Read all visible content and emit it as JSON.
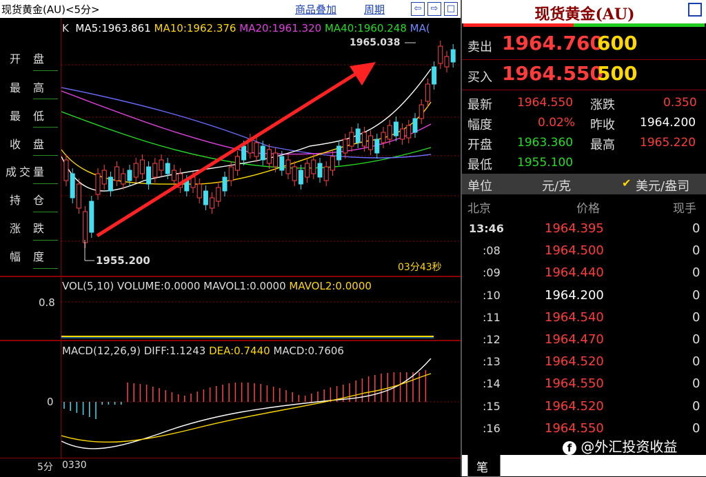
{
  "header": {
    "title": "现货黄金(AU)<5分>",
    "overlay_label": "商品叠加",
    "period_label": "周期",
    "nav_prev": "⇦",
    "nav_next": "⇨",
    "nav_layout": "□"
  },
  "left_labels": [
    "开盘",
    "最高",
    "最低",
    "收盘",
    "成交量",
    "持仓",
    "涨跌",
    "幅度"
  ],
  "kline_legend": {
    "prefix": "K",
    "ma5": "MA5:1963.861",
    "ma10": "MA10:1962.376",
    "ma20": "MA20:1961.320",
    "ma40": "MA40:1960.248",
    "ma_more": "MA(",
    "colors": {
      "ma5": "#ffffff",
      "ma10": "#ffd800",
      "ma20": "#e040e0",
      "ma40": "#22dd22"
    }
  },
  "annotations": {
    "high": "1965.038",
    "low": "1955.200",
    "countdown": "03分43秒"
  },
  "volume_legend": {
    "label": "VOL(5,10) VOLUME:0.0000 MAVOL1:0.0000",
    "mavol2": "MAVOL2:0.0000",
    "axis": "0.8"
  },
  "macd_legend": {
    "label": "MACD(12,26,9)",
    "diff": "DIFF:1.1243",
    "dea": "DEA:0.7440",
    "macd": "MACD:0.7606",
    "axis_zero": "0"
  },
  "footer": {
    "period": "5分",
    "date": "0330"
  },
  "quote": {
    "title": "现货黄金(AU)",
    "sell_label": "卖出",
    "sell_price": "1964.760",
    "sell_vol": "600",
    "buy_label": "买入",
    "buy_price": "1964.550",
    "buy_vol": "500",
    "latest_label": "最新",
    "latest": "1964.550",
    "change_label": "涨跌",
    "change": "0.350",
    "pct_label": "幅度",
    "pct": "0.02%",
    "prev_label": "昨收",
    "prev": "1964.200",
    "open_label": "开盘",
    "open": "1963.360",
    "high_label": "最高",
    "high": "1965.220",
    "low_label": "最低",
    "low": "1955.100",
    "unit_label": "单位",
    "unit_value": "元/克",
    "unit_alt": "美元/盎司",
    "tick_headers": [
      "北京",
      "价格",
      "现手"
    ],
    "ticks": [
      {
        "time": "13:46",
        "price": "1964.395",
        "vol": "0",
        "up": true
      },
      {
        "time": ":08",
        "price": "1964.500",
        "vol": "0",
        "up": true
      },
      {
        "time": ":09",
        "price": "1964.440",
        "vol": "0",
        "up": true
      },
      {
        "time": ":10",
        "price": "1964.200",
        "vol": "0",
        "up": false
      },
      {
        "time": ":11",
        "price": "1964.540",
        "vol": "0",
        "up": true
      },
      {
        "time": ":12",
        "price": "1964.470",
        "vol": "0",
        "up": true
      },
      {
        "time": ":13",
        "price": "1964.520",
        "vol": "0",
        "up": true
      },
      {
        "time": ":14",
        "price": "1964.550",
        "vol": "0",
        "up": true
      },
      {
        "time": ":15",
        "price": "1964.520",
        "vol": "0",
        "up": true
      },
      {
        "time": ":16",
        "price": "1964.550",
        "vol": "0",
        "up": true
      }
    ],
    "tab": "笔",
    "watermark": "@外汇投资收益"
  }
}
